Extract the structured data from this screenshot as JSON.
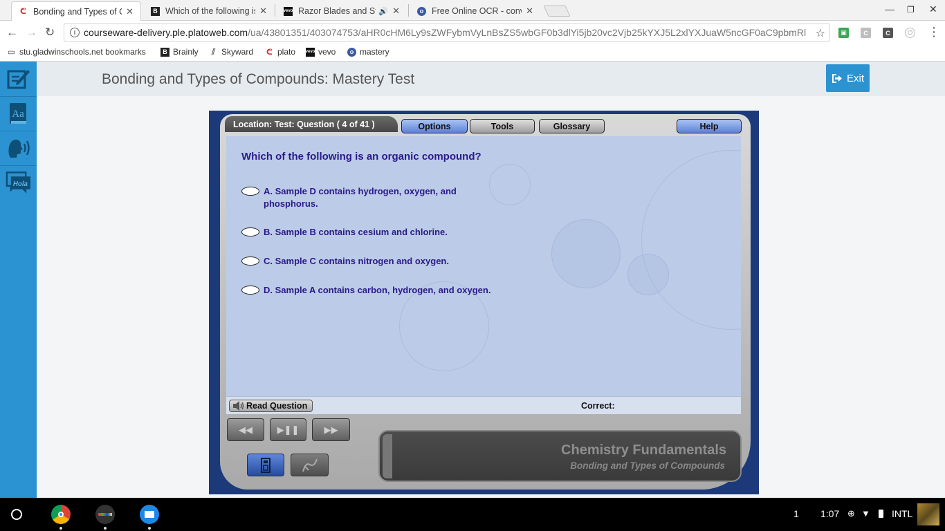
{
  "browser": {
    "tabs": [
      {
        "title": "Bonding and Types of Co",
        "active": true
      },
      {
        "title": "Which of the following is",
        "active": false
      },
      {
        "title": "Razor Blades and Ste",
        "active": false
      },
      {
        "title": "Free Online OCR - conve",
        "active": false
      }
    ],
    "url_host": "courseware-delivery.ple.platoweb.com",
    "url_path": "/ua/43801351/403074753/aHR0cHM6Ly9sZWFybmVyLnBsZS5wbGF0b3dlYi5jb20vc2Vjb25kYXJ5L2xlYXJuaW5ncGF0aC9pbmRl",
    "bookmarks": [
      "stu.gladwinschools.net bookmarks",
      "Brainly",
      "Skyward",
      "plato",
      "vevo",
      "mastery"
    ]
  },
  "app": {
    "title": "Bonding and Types of Compounds: Mastery Test",
    "exit_label": "Exit",
    "sidebar_icons": [
      "notes-icon",
      "dictionary-icon",
      "read-aloud-icon",
      "translate-icon"
    ],
    "sidebar_hola": "Hola",
    "sidebar_aa": "Aa"
  },
  "player": {
    "location": "Location:  Test:  Question ( 4 of 41 )",
    "nav": {
      "options": "Options",
      "tools": "Tools",
      "glossary": "Glossary",
      "help": "Help"
    },
    "question": "Which of the following is an organic compound?",
    "choices": [
      "A. Sample D contains hydrogen, oxygen, and phosphorus.",
      "B. Sample B contains cesium and chlorine.",
      "C. Sample C contains nitrogen and oxygen.",
      "D. Sample A contains carbon, hydrogen, and oxygen."
    ],
    "read_question": "Read Question",
    "correct_label": "Correct:",
    "course_title": "Chemistry Fundamentals",
    "course_subtitle": "Bonding and Types of Compounds"
  },
  "taskbar": {
    "notification_count": "1",
    "time": "1:07",
    "keyboard": "INTL"
  },
  "colors": {
    "sidebar": "#2b93d1",
    "player_frame": "#1c3a7a",
    "question_text": "#2a1a8a",
    "question_panel": "#bccbe8"
  }
}
